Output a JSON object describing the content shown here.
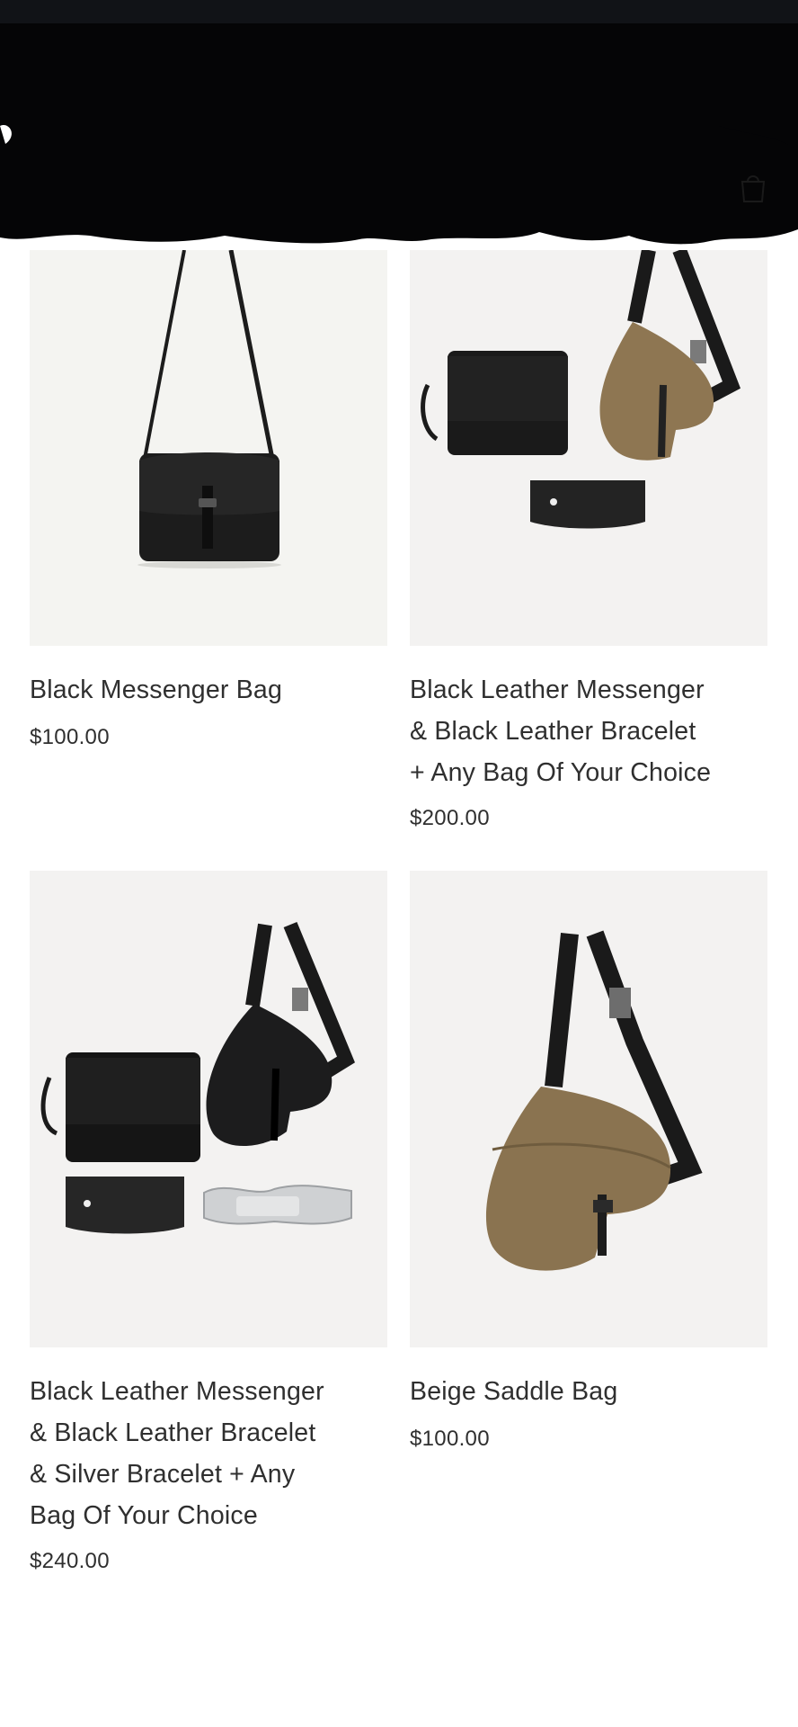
{
  "header": {
    "cart_icon": "shopping-bag-icon"
  },
  "products": [
    {
      "name": "Black Messenger Bag",
      "price": "$100.00"
    },
    {
      "name": "Black Leather Messenger & Black Leather Bracelet + Any Bag Of Your Choice",
      "price": "$200.00",
      "name_lines": [
        "Black Leather Messenger",
        "& Black Leather Bracelet",
        "+ Any Bag Of Your Choice"
      ]
    },
    {
      "name": "Black Leather Messenger & Black Leather Bracelet & Silver Bracelet + Any Bag Of Your Choice",
      "price": "$240.00",
      "name_lines": [
        "Black Leather Messenger",
        "& Black Leather Bracelet",
        "& Silver Bracelet + Any",
        "Bag Of Your Choice"
      ]
    },
    {
      "name": "Beige Saddle Bag",
      "price": "$100.00"
    }
  ]
}
